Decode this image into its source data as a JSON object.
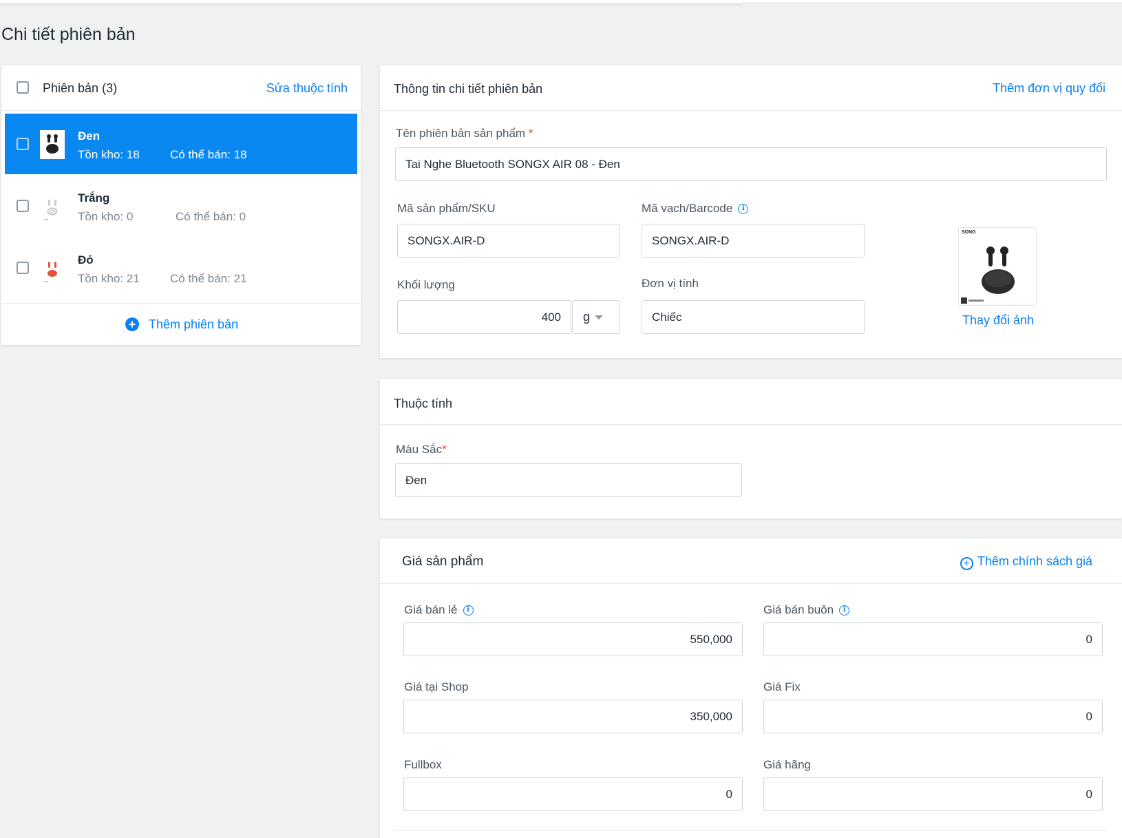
{
  "page": {
    "title": "Chi tiết phiên bản"
  },
  "variants_panel": {
    "header_label": "Phiên bản (3)",
    "edit_attributes_link": "Sửa thuộc tính",
    "items": [
      {
        "name": "Đen",
        "stock": "Tồn kho: 18",
        "sellable": "Có thể bán: 18",
        "selected": true
      },
      {
        "name": "Trắng",
        "stock": "Tồn kho: 0",
        "sellable": "Có thể bán: 0",
        "selected": false
      },
      {
        "name": "Đỏ",
        "stock": "Tồn kho: 21",
        "sellable": "Có thể bán: 21",
        "selected": false
      }
    ],
    "add_variant_label": "Thêm phiên bản"
  },
  "detail": {
    "title": "Thông tin chi tiết phiên bản",
    "add_unit_link": "Thêm đơn vị quy đổi",
    "name_label": "Tên phiên bản sản phẩm",
    "name_value": "Tai Nghe Bluetooth SONGX AIR 08 - Đen",
    "sku_label": "Mã sản phẩm/SKU",
    "sku_value": "SONGX.AIR-D",
    "barcode_label": "Mã vạch/Barcode",
    "barcode_value": "SONGX.AIR-D",
    "weight_label": "Khối lượng",
    "weight_value": "400",
    "weight_unit": "g",
    "unit_label": "Đơn vị tính",
    "unit_value": "Chiếc",
    "image_brand_text": "SONG",
    "change_image_link": "Thay đổi ảnh"
  },
  "attributes": {
    "title": "Thuộc tính",
    "color_label": "Màu Sắc",
    "color_value": "Đen"
  },
  "prices": {
    "title": "Giá sản phẩm",
    "add_policy_link": "Thêm chính sách giá",
    "retail_label": "Giá bán lẻ",
    "retail_value": "550,000",
    "wholesale_label": "Giá bán buôn",
    "wholesale_value": "0",
    "shop_label": "Giá tại Shop",
    "shop_value": "350,000",
    "fix_label": "Giá Fix",
    "fix_value": "0",
    "fullbox_label": "Fullbox",
    "fullbox_value": "0",
    "brand_label": "Giá hãng",
    "brand_value": "0"
  },
  "colors": {
    "accent": "#0a88f2",
    "link": "#0a81ee",
    "required": "#e5484d"
  },
  "icons": {
    "info": "info-icon",
    "plus": "plus-circle-icon",
    "caret": "caret-down-icon"
  }
}
